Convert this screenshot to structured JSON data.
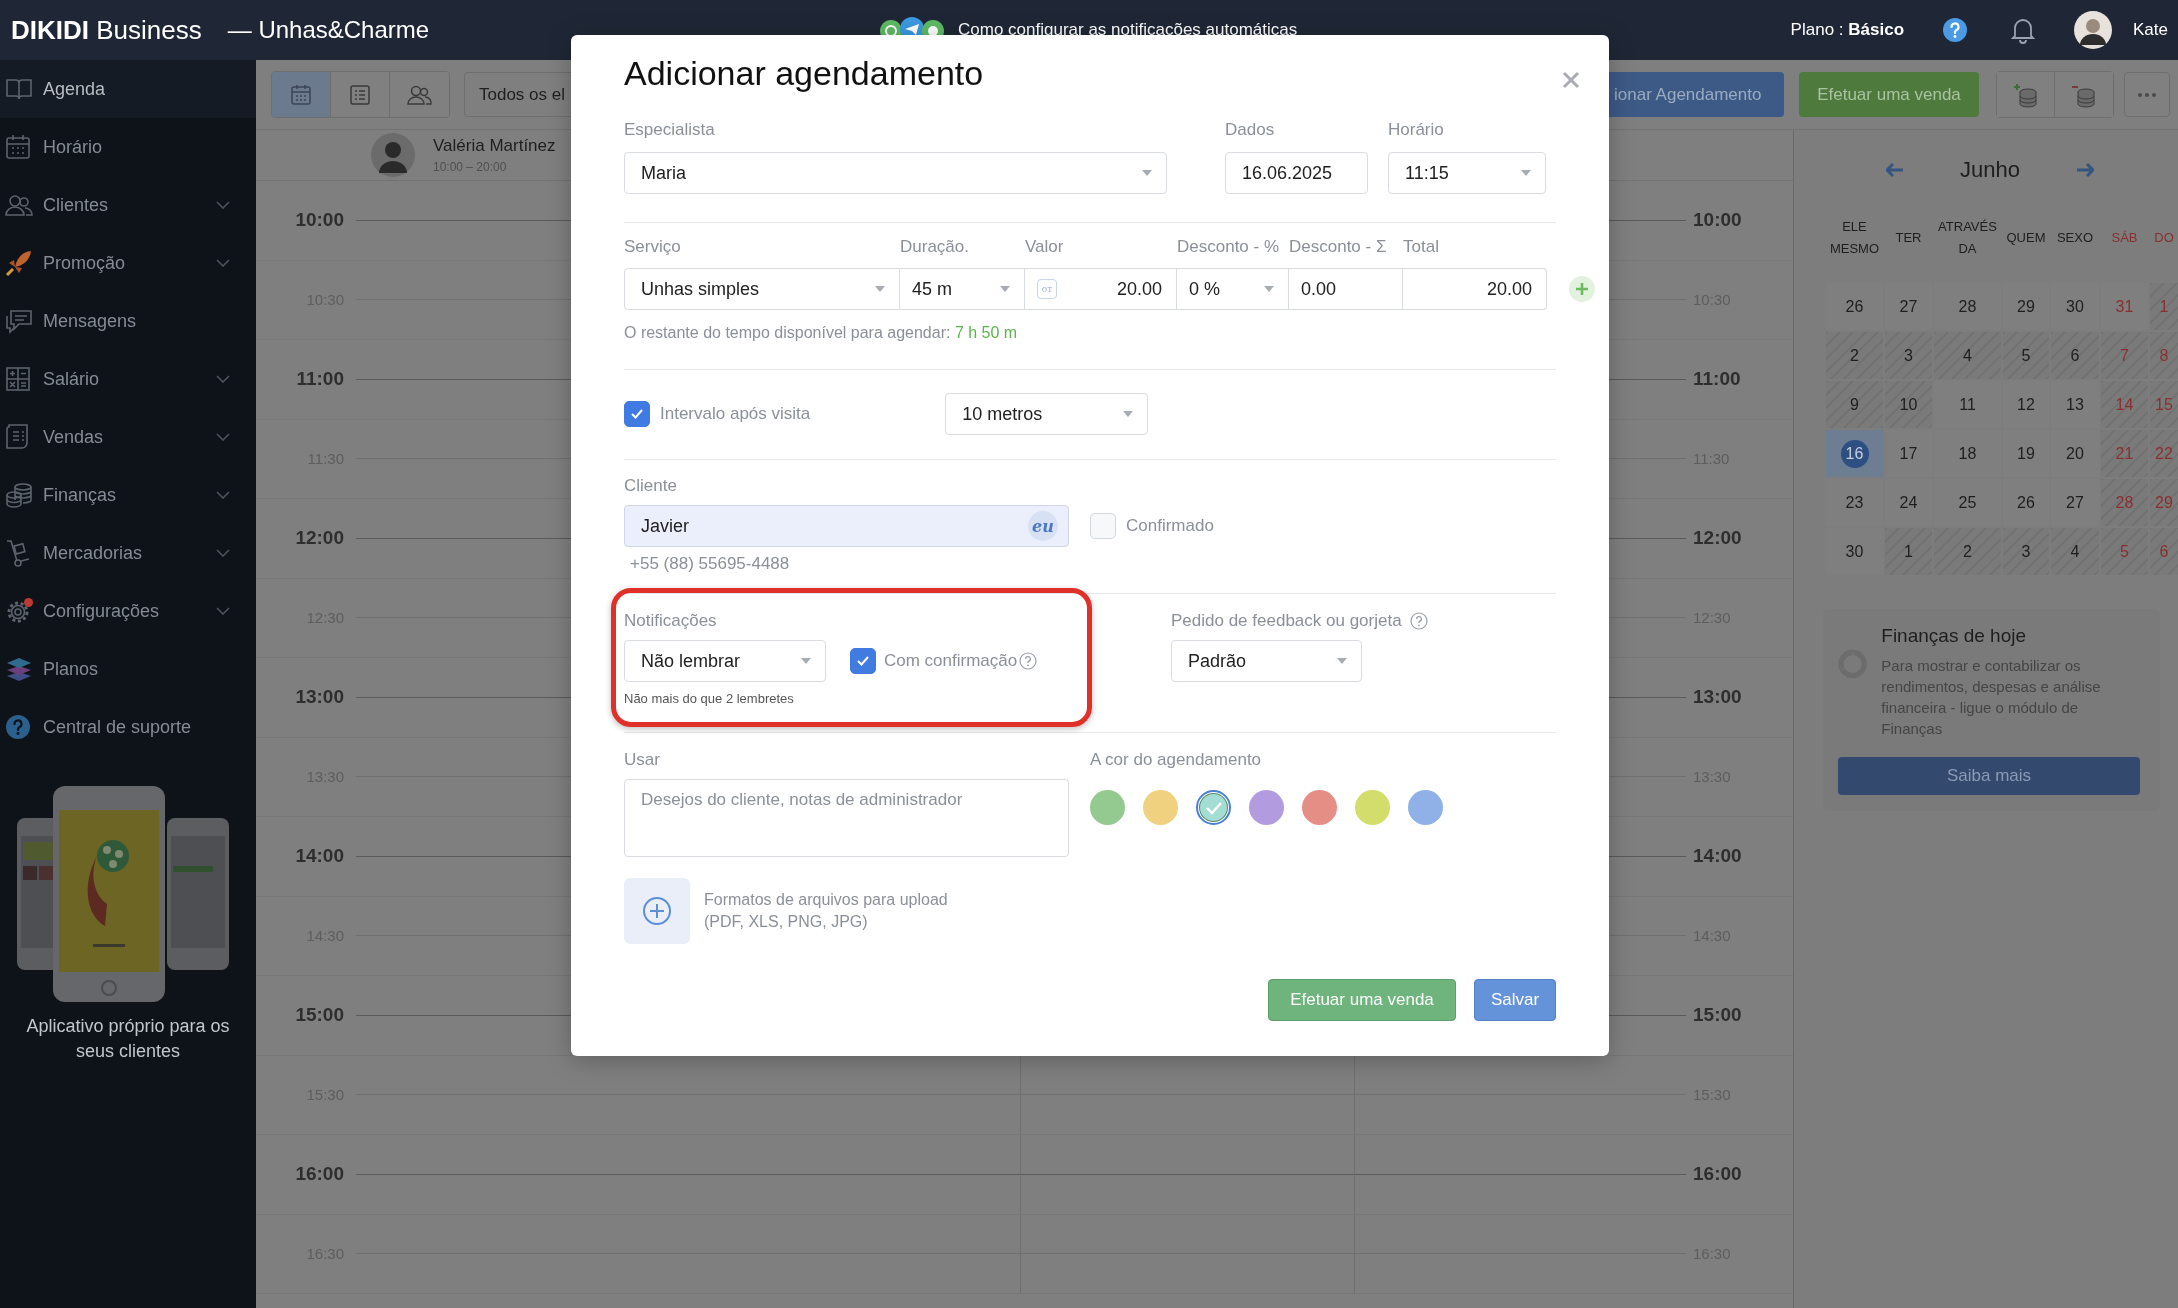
{
  "header": {
    "brand": "**DIKIDI** Business",
    "workspace": "— Unhas&Charme",
    "announcement": "Como configurar as notificações automáticas",
    "plan": "Plano : **Básico**",
    "user": "Kate"
  },
  "sidebar": {
    "items": [
      {
        "label": "Agenda",
        "selected": true,
        "expandable": false,
        "alert": false
      },
      {
        "label": "Horário",
        "selected": false,
        "expandable": false,
        "alert": false
      },
      {
        "label": "Clientes",
        "selected": false,
        "expandable": true,
        "alert": false
      },
      {
        "label": "Promoção",
        "selected": false,
        "expandable": true,
        "alert": false
      },
      {
        "label": "Mensagens",
        "selected": false,
        "expandable": false,
        "alert": false
      },
      {
        "label": "Salário",
        "selected": false,
        "expandable": true,
        "alert": false
      },
      {
        "label": "Vendas",
        "selected": false,
        "expandable": true,
        "alert": false
      },
      {
        "label": "Finanças",
        "selected": false,
        "expandable": true,
        "alert": false
      },
      {
        "label": "Mercadorias",
        "selected": false,
        "expandable": true,
        "alert": false
      },
      {
        "label": "Configurações",
        "selected": false,
        "expandable": true,
        "alert": true
      },
      {
        "label": "Planos",
        "selected": false,
        "expandable": false,
        "alert": false
      },
      {
        "label": "Central de suporte",
        "selected": false,
        "expandable": false,
        "alert": false
      }
    ],
    "promo": "Aplicativo próprio para os seus clientes"
  },
  "toolbar": {
    "views": [
      {
        "selected": true
      },
      {
        "selected": false
      },
      {
        "selected": false
      }
    ],
    "staff_filter": "Todos os el",
    "add_button": "ionar Agendamento",
    "sale_button": "Efetuar uma venda"
  },
  "schedule": {
    "staff": [
      {
        "name": "Valéria Martínez",
        "hours": "10:00 – 20:00"
      }
    ],
    "times": [
      {
        "kind": "hour",
        "left": "10:00",
        "right": "10:00"
      },
      {
        "kind": "half",
        "left": "10:30",
        "right": "10:30"
      },
      {
        "kind": "hour",
        "left": "11:00",
        "right": "11:00"
      },
      {
        "kind": "half",
        "left": "11:30",
        "right": "11:30"
      },
      {
        "kind": "hour",
        "left": "12:00",
        "right": "12:00"
      },
      {
        "kind": "half",
        "left": "12:30",
        "right": "12:30"
      },
      {
        "kind": "hour",
        "left": "13:00",
        "right": "13:00"
      },
      {
        "kind": "half",
        "left": "13:30",
        "right": "13:30"
      },
      {
        "kind": "hour",
        "left": "14:00",
        "right": "14:00"
      },
      {
        "kind": "half",
        "left": "14:30",
        "right": "14:30"
      },
      {
        "kind": "hour",
        "left": "15:00",
        "right": "15:00"
      },
      {
        "kind": "half",
        "left": "15:30",
        "right": "15:30"
      },
      {
        "kind": "hour",
        "left": "16:00",
        "right": "16:00"
      },
      {
        "kind": "half",
        "left": "16:30",
        "right": "16:30"
      }
    ]
  },
  "calendar": {
    "month": "Junho",
    "weekdays": [
      {
        "label": "ELE MESMO",
        "weekend": false
      },
      {
        "label": "TER",
        "weekend": false
      },
      {
        "label": "ATRAVÉS DA",
        "weekend": false
      },
      {
        "label": "QUEM",
        "weekend": false
      },
      {
        "label": "SEXO",
        "weekend": false
      },
      {
        "label": "SÁB",
        "weekend": true
      },
      {
        "label": "DO",
        "weekend": true
      }
    ],
    "weeks": [
      [
        {
          "day": "26",
          "unavailable": false,
          "selected": false
        },
        {
          "day": "27",
          "unavailable": false,
          "selected": false
        },
        {
          "day": "28",
          "unavailable": false,
          "selected": false
        },
        {
          "day": "29",
          "unavailable": false,
          "selected": false
        },
        {
          "day": "30",
          "unavailable": false,
          "selected": false
        },
        {
          "day": "31",
          "unavailable": false,
          "selected": false
        },
        {
          "day": "1",
          "unavailable": true,
          "selected": false
        }
      ],
      [
        {
          "day": "2",
          "unavailable": true,
          "selected": false
        },
        {
          "day": "3",
          "unavailable": true,
          "selected": false
        },
        {
          "day": "4",
          "unavailable": true,
          "selected": false
        },
        {
          "day": "5",
          "unavailable": true,
          "selected": false
        },
        {
          "day": "6",
          "unavailable": true,
          "selected": false
        },
        {
          "day": "7",
          "unavailable": true,
          "selected": false
        },
        {
          "day": "8",
          "unavailable": true,
          "selected": false
        }
      ],
      [
        {
          "day": "9",
          "unavailable": true,
          "selected": false
        },
        {
          "day": "10",
          "unavailable": true,
          "selected": false
        },
        {
          "day": "11",
          "unavailable": false,
          "selected": false
        },
        {
          "day": "12",
          "unavailable": false,
          "selected": false
        },
        {
          "day": "13",
          "unavailable": false,
          "selected": false
        },
        {
          "day": "14",
          "unavailable": true,
          "selected": false
        },
        {
          "day": "15",
          "unavailable": true,
          "selected": false
        }
      ],
      [
        {
          "day": "16",
          "unavailable": false,
          "selected": true
        },
        {
          "day": "17",
          "unavailable": false,
          "selected": false
        },
        {
          "day": "18",
          "unavailable": false,
          "selected": false
        },
        {
          "day": "19",
          "unavailable": false,
          "selected": false
        },
        {
          "day": "20",
          "unavailable": false,
          "selected": false
        },
        {
          "day": "21",
          "unavailable": true,
          "selected": false
        },
        {
          "day": "22",
          "unavailable": true,
          "selected": false
        }
      ],
      [
        {
          "day": "23",
          "unavailable": false,
          "selected": false
        },
        {
          "day": "24",
          "unavailable": false,
          "selected": false
        },
        {
          "day": "25",
          "unavailable": false,
          "selected": false
        },
        {
          "day": "26",
          "unavailable": false,
          "selected": false
        },
        {
          "day": "27",
          "unavailable": false,
          "selected": false
        },
        {
          "day": "28",
          "unavailable": true,
          "selected": false
        },
        {
          "day": "29",
          "unavailable": true,
          "selected": false
        }
      ],
      [
        {
          "day": "30",
          "unavailable": false,
          "selected": false
        },
        {
          "day": "1",
          "unavailable": true,
          "selected": false
        },
        {
          "day": "2",
          "unavailable": true,
          "selected": false
        },
        {
          "day": "3",
          "unavailable": true,
          "selected": false
        },
        {
          "day": "4",
          "unavailable": true,
          "selected": false
        },
        {
          "day": "5",
          "unavailable": true,
          "selected": false
        },
        {
          "day": "6",
          "unavailable": true,
          "selected": false
        }
      ]
    ]
  },
  "finance_card": {
    "title": "Finanças de hoje",
    "text": "Para mostrar e contabilizar os rendimentos, despesas e análise financeira - ligue o módulo de Finanças",
    "button": "Saiba mais"
  },
  "modal": {
    "title": "Adicionar agendamento",
    "specialist": {
      "label": "Especialista",
      "value": "Maria"
    },
    "date": {
      "label": "Dados",
      "value": "16.06.2025"
    },
    "time": {
      "label": "Horário",
      "value": "11:15"
    },
    "service_row": [
      {
        "kind": "select",
        "label": "Serviço",
        "value": "Unhas simples"
      },
      {
        "kind": "select",
        "label": "Duração.",
        "value": "45 m"
      },
      {
        "kind": "price",
        "label": "Valor",
        "value": "20.00",
        "prefix": "от"
      },
      {
        "kind": "select",
        "label": "Desconto - %",
        "value": "0 %"
      },
      {
        "kind": "input",
        "label": "Desconto - Σ",
        "value": "0.00"
      },
      {
        "kind": "total",
        "label": "Total",
        "value": "20.00"
      }
    ],
    "remaining": {
      "label": "O restante do tempo disponível para agendar:",
      "value": "7 h 50 m"
    },
    "interval": {
      "checked": true,
      "label": "Intervalo após visita",
      "value": "10 metros"
    },
    "client": {
      "label": "Cliente",
      "value": "Javier",
      "badge": "eu",
      "confirmed": false,
      "confirmed_label": "Confirmado",
      "phone": "+55 (88) 55695-4488"
    },
    "notifications": {
      "highlighted": true,
      "label": "Notificações",
      "value": "Não lembrar",
      "confirmation_checked": true,
      "confirmation_label": "Com confirmação",
      "hint": "Não mais do que 2 lembretes"
    },
    "feedback": {
      "label": "Pedido de feedback ou gorjeta",
      "value": "Padrão"
    },
    "notes": {
      "label": "Usar",
      "placeholder": "Desejos do cliente, notas de administrador"
    },
    "colors": {
      "label": "A cor do agendamento",
      "options": [
        {
          "color": "#94c98f",
          "selected": false
        },
        {
          "color": "#efd17f",
          "selected": false
        },
        {
          "color": "#a3ddd3",
          "selected": true
        },
        {
          "color": "#b39be0",
          "selected": false
        },
        {
          "color": "#e58e86",
          "selected": false
        },
        {
          "color": "#d2dd6c",
          "selected": false
        },
        {
          "color": "#8fb1e8",
          "selected": false
        }
      ]
    },
    "upload": {
      "title": "Formatos de arquivos para upload",
      "formats": "(PDF, XLS, PNG, JPG)"
    },
    "buttons": [
      {
        "kind": "sale",
        "label": "Efetuar uma venda"
      },
      {
        "kind": "primary",
        "label": "Salvar"
      }
    ]
  }
}
